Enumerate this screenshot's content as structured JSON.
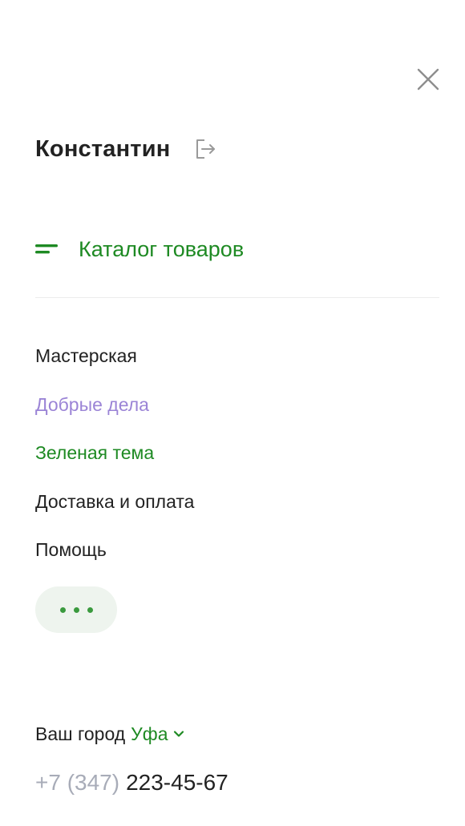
{
  "header": {
    "close_icon": "close-icon"
  },
  "user": {
    "name": "Константин",
    "logout_icon": "logout-icon"
  },
  "catalog": {
    "label": "Каталог товаров",
    "icon": "menu-lines-icon"
  },
  "nav": {
    "items": [
      {
        "label": "Мастерская"
      },
      {
        "label": "Добрые дела"
      },
      {
        "label": "Зеленая тема"
      },
      {
        "label": "Доставка и оплата"
      },
      {
        "label": "Помощь"
      }
    ],
    "more_icon": "more-dots-icon"
  },
  "city": {
    "label": "Ваш город",
    "value": "Уфа",
    "chevron_icon": "chevron-down-icon"
  },
  "contact": {
    "phone_prefix": "+7 (347)",
    "phone_number": "223-45-67"
  },
  "colors": {
    "accent_green": "#1e8a23",
    "purple_link": "#9b84d6",
    "text_dark": "#222222",
    "muted_gray": "#a8acb8",
    "more_bg": "#eef4ee"
  }
}
